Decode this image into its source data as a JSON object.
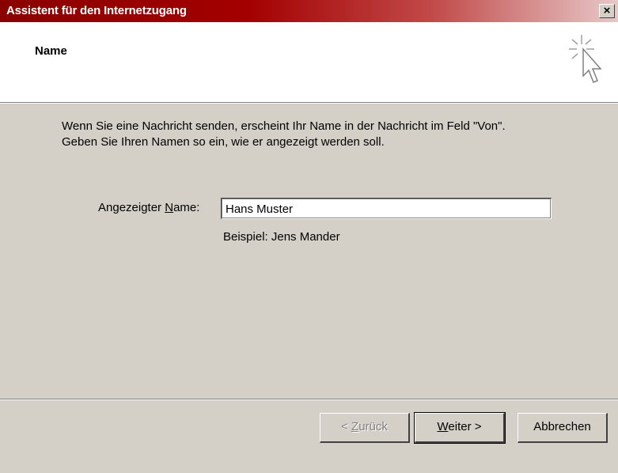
{
  "window": {
    "title": "Assistent für den Internetzugang",
    "close_label": "×"
  },
  "header": {
    "heading": "Name",
    "icon": "wizard-cursor-icon"
  },
  "body": {
    "description_line1": "Wenn Sie eine Nachricht senden, erscheint Ihr Name in der Nachricht im Feld \"Von\".",
    "description_line2": "Geben Sie Ihren Namen so ein, wie er angezeigt werden soll.",
    "name_label_prefix": "Angezeigter ",
    "name_label_mnemonic": "N",
    "name_label_suffix": "ame:",
    "name_value": "Hans Muster",
    "example": "Beispiel: Jens Mander"
  },
  "footer": {
    "back_prefix": "< ",
    "back_mnemonic": "Z",
    "back_suffix": "urück",
    "next_mnemonic": "W",
    "next_suffix": "eiter >",
    "cancel_label": "Abbrechen"
  },
  "colors": {
    "title_bar": "#8a0000",
    "dialog_bg": "#d4d0c8"
  }
}
